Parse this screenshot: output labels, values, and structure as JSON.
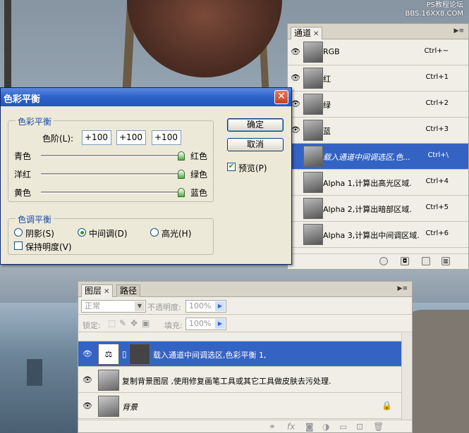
{
  "watermark": {
    "line1": "PS教程论坛",
    "line2": "BBS.16XX8.COM"
  },
  "channels": {
    "tab": "通道",
    "rows": [
      {
        "name": "RGB",
        "shortcut": "Ctrl+~",
        "eye": true
      },
      {
        "name": "红",
        "shortcut": "Ctrl+1",
        "eye": true
      },
      {
        "name": "绿",
        "shortcut": "Ctrl+2",
        "eye": true
      },
      {
        "name": "蓝",
        "shortcut": "Ctrl+3",
        "eye": true
      },
      {
        "name": "载入通道中间调选区,色...",
        "shortcut": "Ctrl+\\",
        "eye": false,
        "selected": true
      },
      {
        "name": "Alpha 1,计算出高光区域.",
        "shortcut": "Ctrl+4",
        "eye": false
      },
      {
        "name": "Alpha 2,计算出暗部区域.",
        "shortcut": "Ctrl+5",
        "eye": false
      },
      {
        "name": "Alpha 3,计算出中间调区域.",
        "shortcut": "Ctrl+6",
        "eye": false
      }
    ]
  },
  "dialog": {
    "title": "色彩平衡",
    "close": "✕",
    "group1": "色彩平衡",
    "levels_label": "色阶(L):",
    "levels": [
      "+100",
      "+100",
      "+100"
    ],
    "sliders": [
      {
        "left": "青色",
        "right": "红色",
        "value": 100
      },
      {
        "left": "洋红",
        "right": "绿色",
        "value": 100
      },
      {
        "left": "黄色",
        "right": "蓝色",
        "value": 100
      }
    ],
    "group2": "色调平衡",
    "tone": {
      "shadows": "阴影(S)",
      "midtones": "中间调(D)",
      "highlights": "高光(H)",
      "selected": "midtones"
    },
    "preserve": "保持明度(V)",
    "ok": "确定",
    "cancel": "取消",
    "preview": "预览(P)",
    "preview_checked": true,
    "preserve_checked": false
  },
  "layers": {
    "tabs": [
      "图层",
      "路径"
    ],
    "blend": "正常",
    "opacity_label": "不透明度:",
    "opacity": "100%",
    "lock_label": "锁定:",
    "fill_label": "填充:",
    "fill": "100%",
    "rows": [
      {
        "name": "载入通道中间调选区,色彩平衡 1,",
        "selected": true
      },
      {
        "name": "复制背景图层 ,使用修复画笔工具或其它工具做皮肤去污处理.",
        "selected": false
      },
      {
        "name": "背景",
        "selected": false,
        "locked": true
      }
    ]
  }
}
